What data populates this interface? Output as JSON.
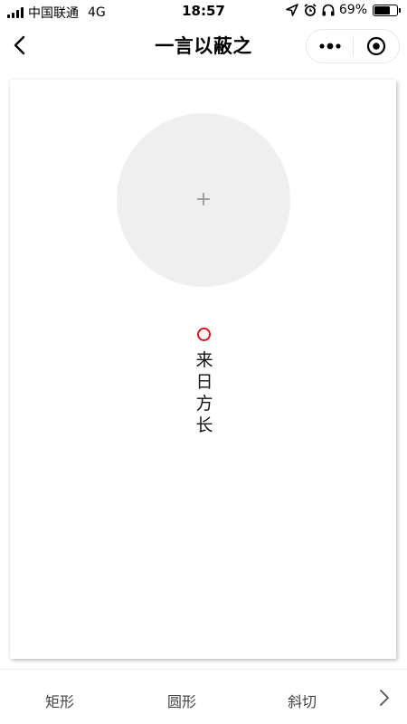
{
  "status_bar": {
    "carrier": "中国联通",
    "network": "4G",
    "time": "18:57",
    "battery_percent": "69%",
    "battery_level": 0.69
  },
  "nav": {
    "title": "一言以蔽之"
  },
  "card": {
    "text": "来日方长",
    "seal_color": "#d9141a",
    "placeholder_color": "#efefef"
  },
  "toolbar": {
    "options": [
      "矩形",
      "圆形",
      "斜切"
    ]
  }
}
